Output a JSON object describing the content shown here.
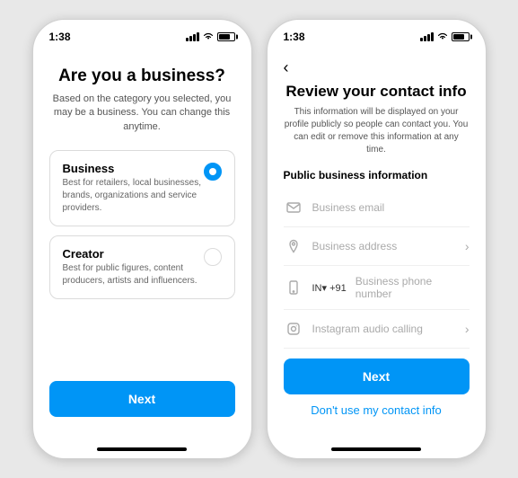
{
  "phone1": {
    "status_time": "1:38",
    "title": "Are you a business?",
    "subtitle": "Based on the category you selected, you may be a business. You can change this anytime.",
    "options": [
      {
        "id": "business",
        "title": "Business",
        "description": "Best for retailers, local businesses, brands, organizations and service providers.",
        "selected": true
      },
      {
        "id": "creator",
        "title": "Creator",
        "description": "Best for public figures, content producers, artists and influencers.",
        "selected": false
      }
    ],
    "next_button": "Next"
  },
  "phone2": {
    "status_time": "1:38",
    "back_icon": "‹",
    "title": "Review your contact info",
    "subtitle": "This information will be displayed on your profile publicly so people can contact you. You can edit or remove this information at any time.",
    "section_label": "Public business information",
    "fields": [
      {
        "id": "email",
        "placeholder": "Business email",
        "type": "email",
        "has_chevron": false
      },
      {
        "id": "address",
        "placeholder": "Business address",
        "type": "location",
        "has_chevron": true
      },
      {
        "id": "phone",
        "placeholder": "Business phone number",
        "type": "phone",
        "prefix": "IN▾ +91",
        "has_chevron": false
      },
      {
        "id": "instagram",
        "placeholder": "Instagram audio calling",
        "type": "instagram",
        "has_chevron": true
      }
    ],
    "next_button": "Next",
    "dont_use_link": "Don't use my contact info"
  }
}
